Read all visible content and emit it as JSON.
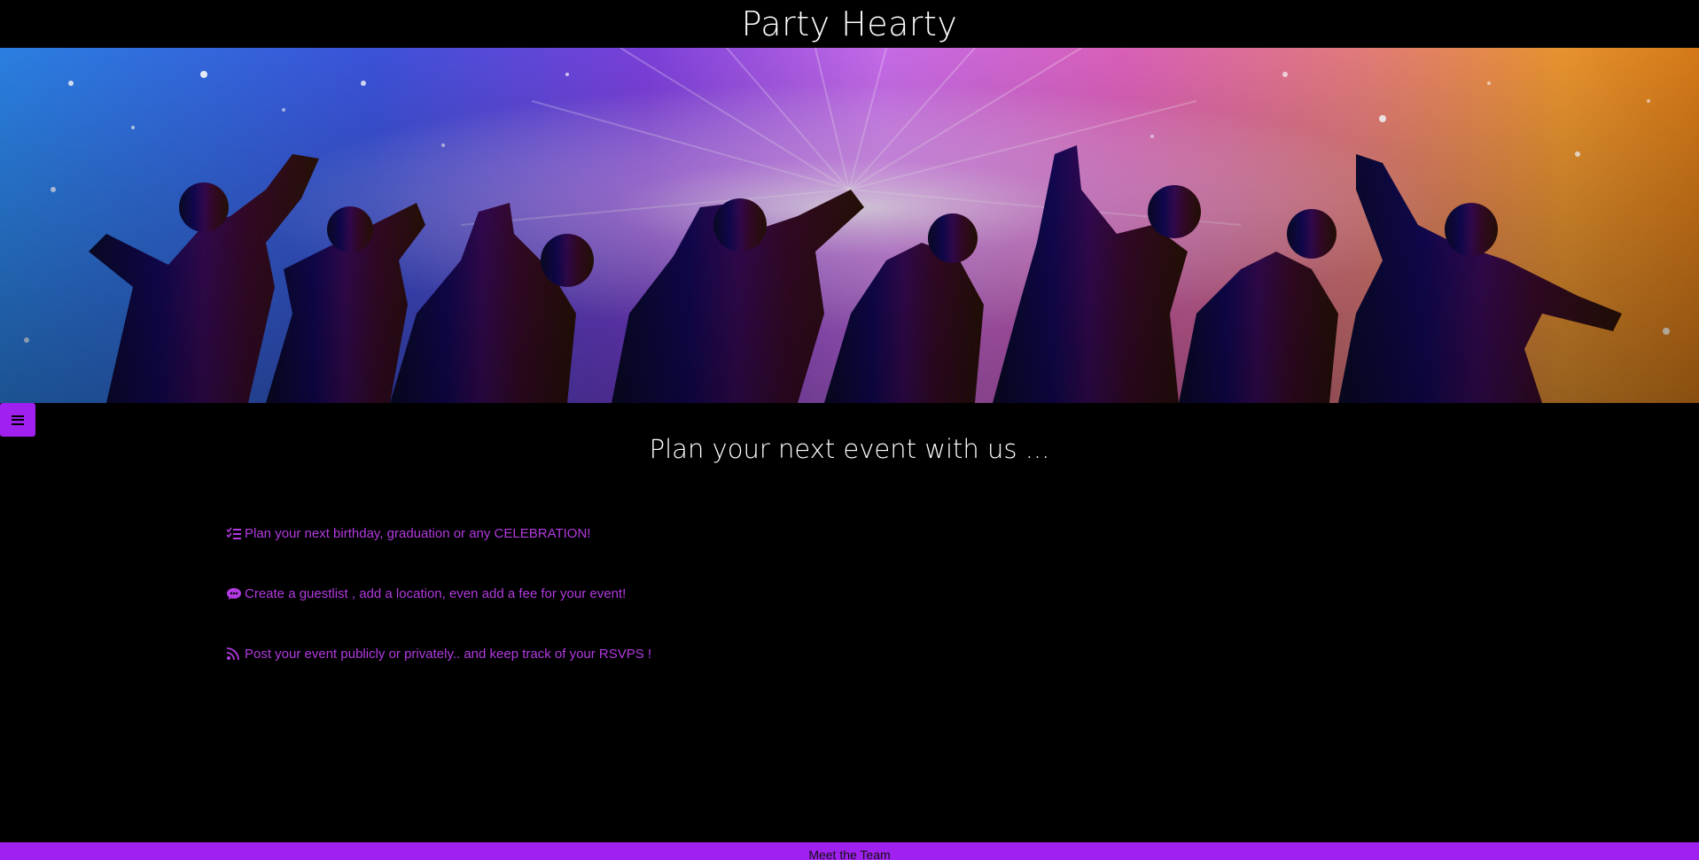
{
  "header": {
    "title": "Party Hearty"
  },
  "hero": {
    "image_name": "party-crowd-silhouette-image"
  },
  "menu": {
    "icon": "hamburger-menu-icon"
  },
  "main": {
    "tagline": "Plan your next event with us ...",
    "features": [
      {
        "icon": "checklist-icon",
        "text": "Plan your next birthday, graduation or any CELEBRATION!"
      },
      {
        "icon": "comment-dots-icon",
        "text": "Create a guestlist , add a location, even add a fee for your event!"
      },
      {
        "icon": "rss-feed-icon",
        "text": "Post your event publicly or privately.. and keep track of your RSVPS !"
      }
    ]
  },
  "footer": {
    "link_label": "Meet the Team"
  },
  "colors": {
    "accent": "#a020f0",
    "feature_text": "#b23ae0",
    "background": "#000000",
    "title_text": "#ffffff"
  }
}
